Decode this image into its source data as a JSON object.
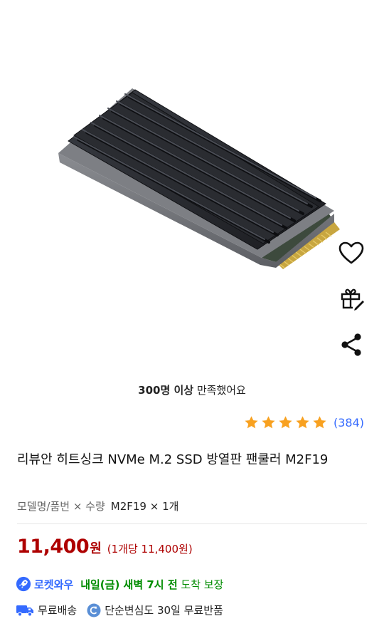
{
  "product": {
    "satisfaction_bold": "300명 이상",
    "satisfaction_rest": " 만족했어요",
    "rating_stars": 5,
    "review_count": "(384)",
    "title": "리뷰안 히트싱크 NVMe M.2 SSD 방열판 팬쿨러 M2F19",
    "option_label": "모델명/품번 × 수량",
    "option_value": "M2F19 × 1개",
    "price": "11,400",
    "price_unit": "원",
    "unit_price": "(1개당 11,400원)"
  },
  "delivery": {
    "rocket_label": "로켓와우",
    "eta_bold": "내일(금) 새벽 7시 전",
    "eta_rest": " 도착 보장"
  },
  "benefits": {
    "free_shipping": "무료배송",
    "free_return": "단순변심도 30일 무료반품"
  },
  "colors": {
    "price_red": "#ae0000",
    "rocket_blue": "#346aff",
    "delivery_green": "#008c00",
    "star_orange": "#f8a120"
  },
  "icons": {
    "wishlist": "heart-icon",
    "gift": "gift-icon",
    "share": "share-icon",
    "rocket": "rocket-icon",
    "truck": "truck-icon",
    "return": "return-icon"
  }
}
